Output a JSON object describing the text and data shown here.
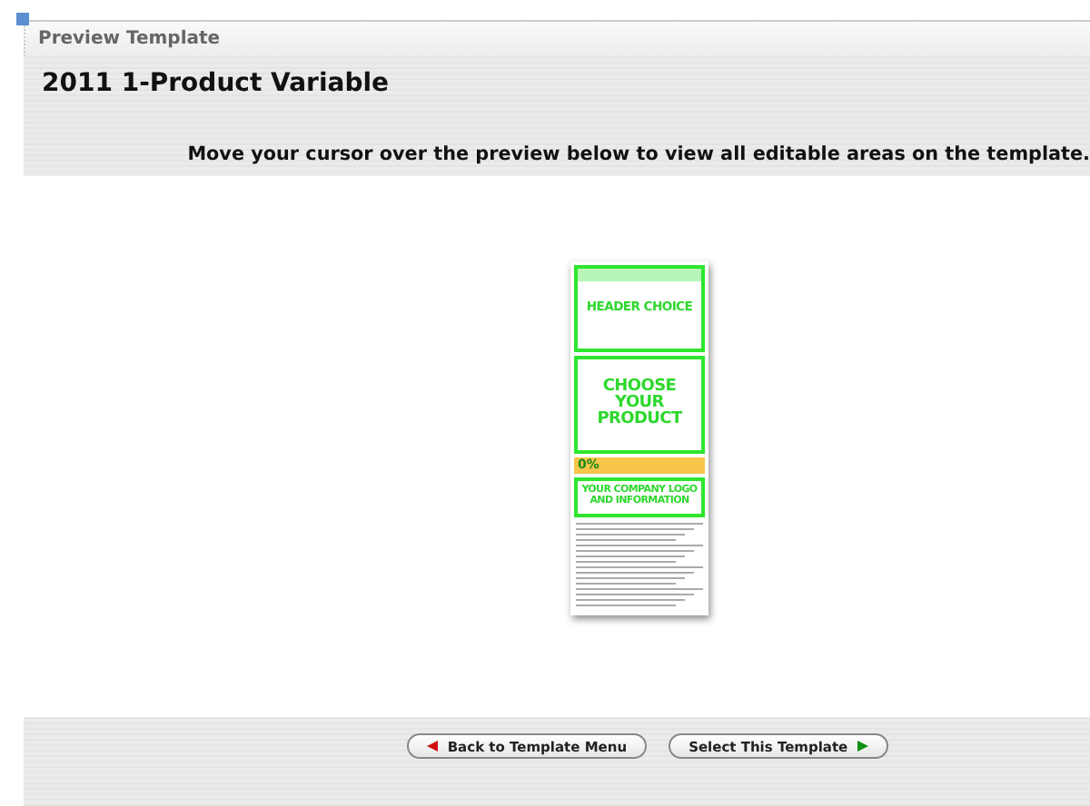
{
  "panel": {
    "title": "Preview Template"
  },
  "template": {
    "name": "2011 1-Product Variable",
    "instruction": "Move your cursor over the preview below to view all editable areas on the template."
  },
  "preview": {
    "header_text": "HEADER CHOICE",
    "product_lines": [
      "CHOOSE",
      "YOUR",
      "PRODUCT"
    ],
    "financing_text": "0%",
    "company_lines": [
      "YOUR COMPANY LOGO",
      "AND INFORMATION"
    ]
  },
  "buttons": [
    {
      "label": "Back to Template Menu",
      "kind": "back"
    },
    {
      "label": "Select This Template",
      "kind": "forward"
    }
  ]
}
